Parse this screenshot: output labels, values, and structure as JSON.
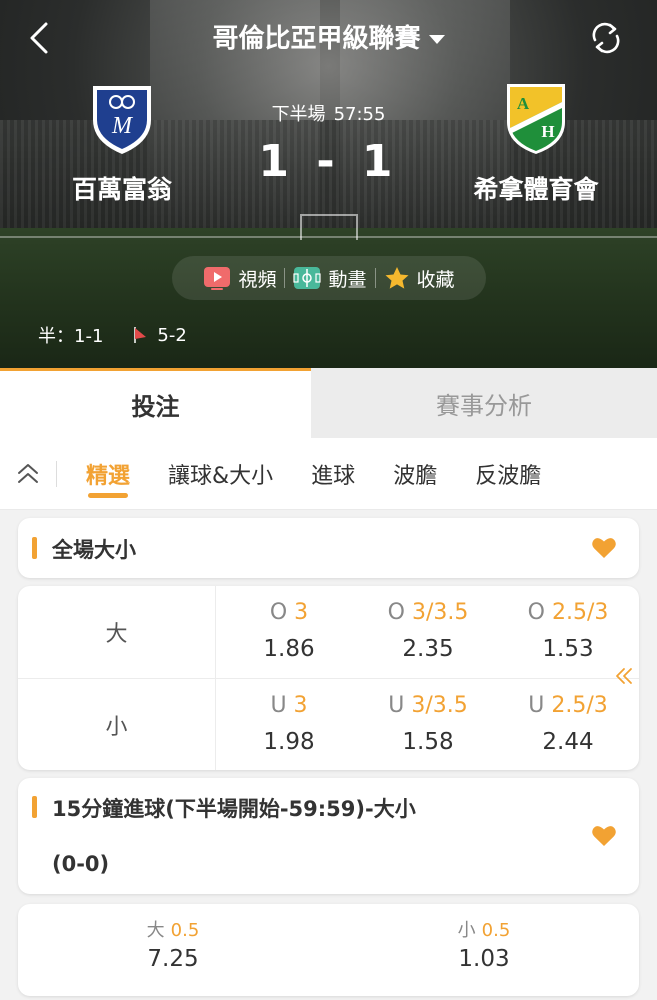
{
  "header": {
    "league_title": "哥倫比亞甲級聯賽",
    "home_team": "百萬富翁",
    "away_team": "希拿體育會",
    "period": "下半場",
    "clock": "57:55",
    "score": "1 - 1",
    "away_crest_letters": [
      "A",
      "H"
    ]
  },
  "media": {
    "video_label": "視頻",
    "animation_label": "動畫",
    "favorite_label": "收藏"
  },
  "half_info": {
    "halftime": "半：1-1",
    "corners": "5-2"
  },
  "main_tabs": [
    {
      "label": "投注",
      "active": true
    },
    {
      "label": "賽事分析",
      "active": false
    }
  ],
  "sub_tabs": [
    {
      "label": "精選",
      "active": true
    },
    {
      "label": "讓球&大小",
      "active": false
    },
    {
      "label": "進球",
      "active": false
    },
    {
      "label": "波膽",
      "active": false
    },
    {
      "label": "反波膽",
      "active": false
    }
  ],
  "market1": {
    "title": "全場大小",
    "rows": [
      {
        "label": "大",
        "cells": [
          {
            "prefix": "O",
            "line": "3",
            "price": "1.86"
          },
          {
            "prefix": "O",
            "line": "3/3.5",
            "price": "2.35"
          },
          {
            "prefix": "O",
            "line": "2.5/3",
            "price": "1.53"
          }
        ]
      },
      {
        "label": "小",
        "cells": [
          {
            "prefix": "U",
            "line": "3",
            "price": "1.98"
          },
          {
            "prefix": "U",
            "line": "3/3.5",
            "price": "1.58"
          },
          {
            "prefix": "U",
            "line": "2.5/3",
            "price": "2.44"
          }
        ]
      }
    ]
  },
  "market2": {
    "title_line1": "15分鐘進球(下半場開始-59:59)-大小",
    "title_line2": "(0-0)",
    "cells": [
      {
        "prefix": "大",
        "line": "0.5",
        "price": "7.25"
      },
      {
        "prefix": "小",
        "line": "0.5",
        "price": "1.03"
      }
    ]
  },
  "colors": {
    "accent": "#f2a233",
    "home_crest": "#1f3f8f",
    "away_crest_top": "#f2c229",
    "away_crest_bottom": "#1f8f3a"
  }
}
